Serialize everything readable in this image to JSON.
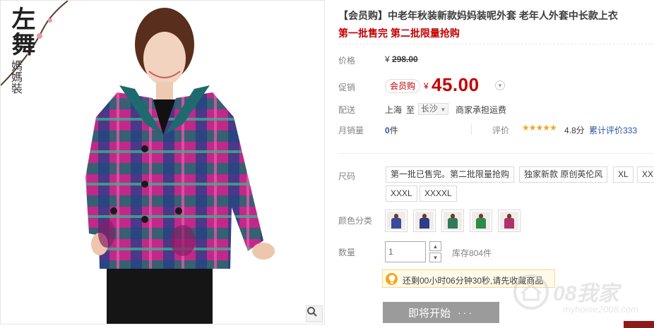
{
  "product": {
    "title": "【会员购】中老年秋装新款妈妈装呢外套 老年人外套中长款上衣",
    "subtitle": "第一批售完 第二批限量抢购"
  },
  "brand": {
    "logo_text_large": "左舞",
    "logo_text_small": "媽媽裝"
  },
  "price": {
    "label": "价格",
    "currency": "¥",
    "original": "298.00"
  },
  "promo": {
    "label": "促销",
    "tag": "会员购",
    "currency": "¥",
    "price": "45.00"
  },
  "shipping": {
    "label": "配送",
    "from": "上海",
    "to_word": "至",
    "to_city": "长沙",
    "fee_note": "商家承担运费"
  },
  "sales": {
    "label": "月销量",
    "count": "0",
    "unit": "件",
    "rating_label": "评价",
    "stars": "★★★★★",
    "score": "4.8分",
    "reviews": "累计评价333"
  },
  "sizes": {
    "label": "尺码",
    "options": [
      "第一批已售完。第二批限量抢购",
      "独家新款 原创英伦风",
      "XL",
      "XXL",
      "XXXL",
      "XXXXL"
    ]
  },
  "colors": {
    "label": "颜色分类",
    "swatches": [
      "#3a4a9c",
      "#2e3c8a",
      "#2e7a5a",
      "#2d8a4a",
      "#b0306a"
    ]
  },
  "quantity": {
    "label": "数量",
    "value": "1",
    "stock": "库存804件"
  },
  "tip": {
    "text": "还剩00小时06分钟30秒,请先收藏商品"
  },
  "buy": {
    "label": "即将开始",
    "dots": "···"
  },
  "watermark": {
    "brand": "08我家",
    "url": "myhome2008.com"
  }
}
